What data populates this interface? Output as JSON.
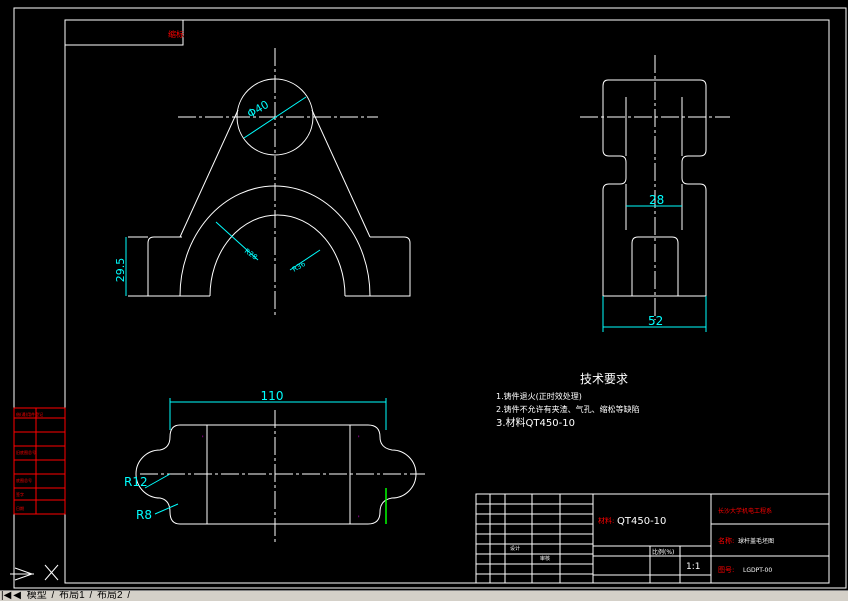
{
  "title_tag": "缩标",
  "dimensions": {
    "top_diameter": "Φ40",
    "height": "29.5",
    "inner_radius": "R28",
    "outer_radius": "R36",
    "width_28": "28",
    "width_52": "52",
    "length_110": "110",
    "r12": "R12",
    "r8": "R8"
  },
  "tech": {
    "heading": "技术要求",
    "line1": "1.铸件退火(正时效处理)",
    "line2": "2.铸件不允许有夹渣、气孔、缩松等缺陷",
    "line3": "3.材料QT450-10"
  },
  "title_block": {
    "material_label": "材料:",
    "material_value": "QT450-10",
    "school": "长沙大学机电工程系",
    "name_label": "名称:",
    "name_value": "球杆盖毛坯图",
    "drawing_no_label": "图号:",
    "drawing_no_value": "LGDPT-00",
    "scale_label": "比例(%)",
    "scale_value": "1:1",
    "designer_label": "设计",
    "checker_label": "审核"
  },
  "left_strip_labels": [
    "借(通)用件登记",
    "旧底图总号",
    "底图总号",
    "签字",
    "日期"
  ],
  "tabs": {
    "model": "模型",
    "layout1": "布局1",
    "layout2": "布局2"
  },
  "colors": {
    "frame": "#ffffff",
    "centerline": "#ffffff",
    "dimension": "#00ffff",
    "text_red": "#ff0000",
    "text_cyan": "#00ffff",
    "accent_green": "#00ff00",
    "accent_magenta": "#ff00ff"
  }
}
